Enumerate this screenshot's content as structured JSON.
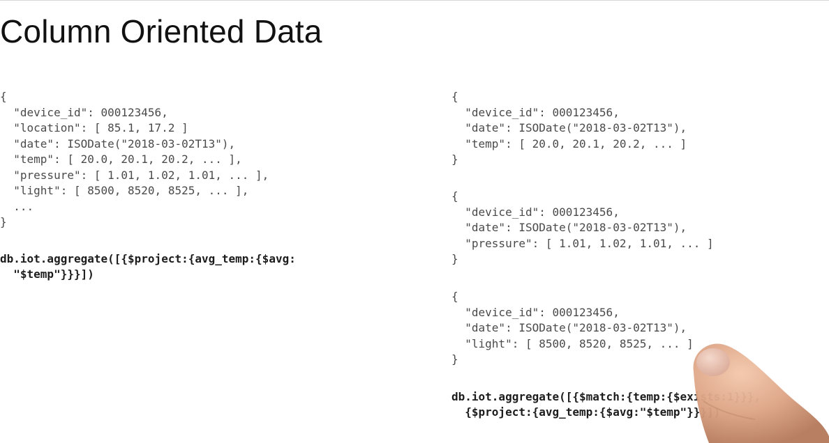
{
  "title": "Column Oriented Data",
  "left_document": {
    "lines": [
      "{",
      "  \"device_id\": 000123456,",
      "  \"location\": [ 85.1, 17.2 ]",
      "  \"date\": ISODate(\"2018-03-02T13\"),",
      "  \"temp\": [ 20.0, 20.1, 20.2, ... ],",
      "  \"pressure\": [ 1.01, 1.02, 1.01, ... ],",
      "  \"light\": [ 8500, 8520, 8525, ... ],",
      "  ...",
      "}"
    ]
  },
  "left_query": {
    "lines": [
      "db.iot.aggregate([{$project:{avg_temp:{$avg:",
      "  \"$temp\"}}}])"
    ]
  },
  "right_documents": [
    {
      "lines": [
        "{",
        "  \"device_id\": 000123456,",
        "  \"date\": ISODate(\"2018-03-02T13\"),",
        "  \"temp\": [ 20.0, 20.1, 20.2, ... ]",
        "}"
      ]
    },
    {
      "lines": [
        "{",
        "  \"device_id\": 000123456,",
        "  \"date\": ISODate(\"2018-03-02T13\"),",
        "  \"pressure\": [ 1.01, 1.02, 1.01, ... ]",
        "}"
      ]
    },
    {
      "lines": [
        "{",
        "  \"device_id\": 000123456,",
        "  \"date\": ISODate(\"2018-03-02T13\"),",
        "  \"light\": [ 8500, 8520, 8525, ... ]",
        "}"
      ]
    }
  ],
  "right_query": {
    "lines": [
      "db.iot.aggregate([{$match:{temp:{$exists:1}}},",
      "  {$project:{avg_temp:{$avg:\"$temp\"}}}])"
    ]
  },
  "colors": {
    "code_text": "#4a4a4a",
    "query_text": "#1c1c1c",
    "title_text": "#111111",
    "background": "#ffffff"
  }
}
